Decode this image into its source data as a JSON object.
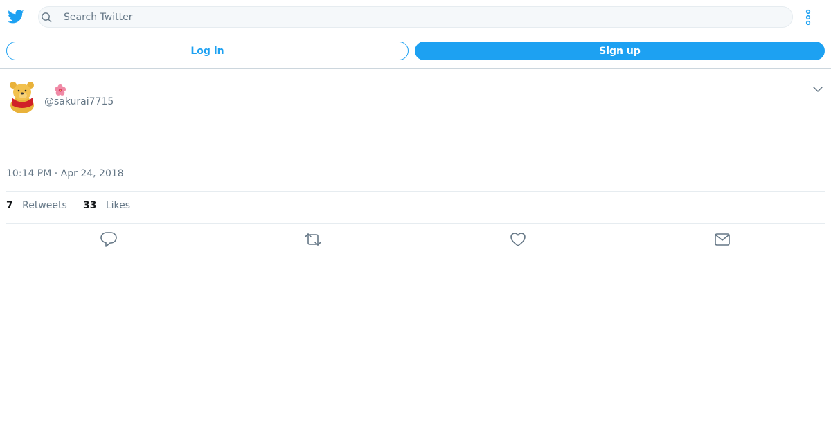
{
  "search": {
    "placeholder": "Search Twitter"
  },
  "auth": {
    "login_label": "Log in",
    "signup_label": "Sign up"
  },
  "tweet": {
    "handle": "@sakurai7715",
    "timestamp": "10:14 PM · Apr 24, 2018",
    "retweets_count": "7",
    "retweets_label": "Retweets",
    "likes_count": "33",
    "likes_label": "Likes"
  },
  "icons": {
    "logo": "twitter-bird-icon",
    "search": "search-icon",
    "more": "more-vertical-icon",
    "name_emoji": "hibiscus-icon",
    "caret": "chevron-down-icon",
    "reply": "reply-icon",
    "retweet": "retweet-icon",
    "like": "heart-icon",
    "share": "envelope-icon"
  },
  "colors": {
    "accent": "#1da1f2",
    "text_secondary": "#657786",
    "border": "#e6ecf0"
  }
}
